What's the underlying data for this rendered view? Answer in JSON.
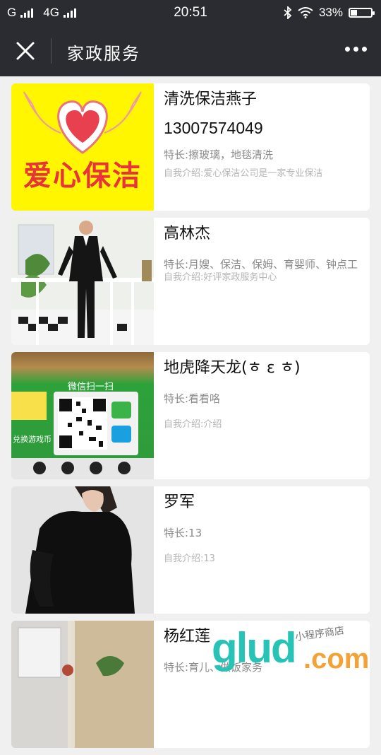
{
  "status_bar": {
    "carrier1": "G",
    "carrier2": "4G",
    "time": "20:51",
    "battery_text": "33%",
    "battery_level": 0.33
  },
  "nav": {
    "title": "家政服务",
    "close_icon": "close-icon",
    "more_icon": "more-dots-icon"
  },
  "items": [
    {
      "name": "清洗保洁燕子",
      "phone": "13007574049",
      "specialty": "特长:擦玻璃，地毯清洗",
      "intro": "自我介绍:爱心保洁公司是一家专业保洁",
      "thumb_text": "爱心保洁"
    },
    {
      "name": "高林杰",
      "specialty": "特长:月嫂、保洁、保姆、育婴师、钟点工",
      "intro": "自我介绍:好评家政服务中心"
    },
    {
      "name": "地虎降天龙(ㅎ ε ㅎ)",
      "specialty": "特长:看看咯",
      "intro": "自我介绍:介绍",
      "thumb_text": "微信扫一扫",
      "thumb_subtext": "兑换游戏币"
    },
    {
      "name": "罗军",
      "specialty": "特长:13",
      "intro": "自我介绍:13"
    },
    {
      "name": "杨红莲",
      "specialty": "特长:育儿、做饭家务"
    }
  ],
  "watermark": {
    "brand": "glud",
    "suffix": ".com",
    "tagline": "小程序商店"
  }
}
